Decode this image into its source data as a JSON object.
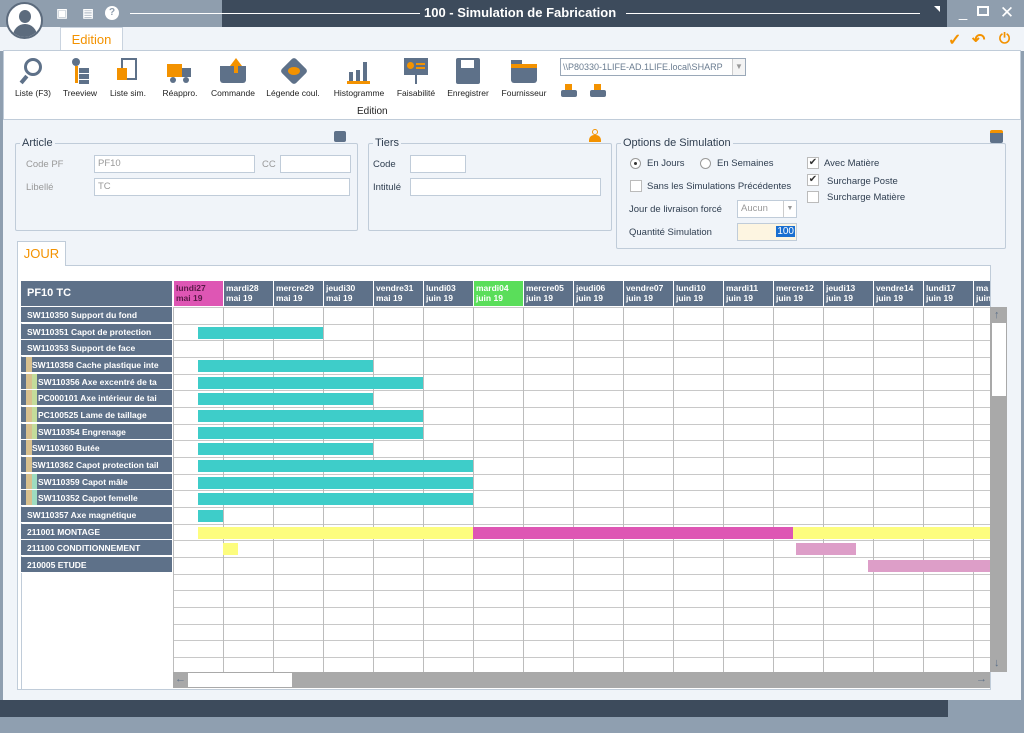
{
  "window": {
    "title": "100 - Simulation de Fabrication",
    "controls": [
      "minimize",
      "maximize",
      "close"
    ]
  },
  "titlebar_icons": [
    "monitor-icon",
    "calculator-icon",
    "help-icon"
  ],
  "ribbon_tab": "Edition",
  "actions": {
    "validate": "✓",
    "undo": "↶",
    "power": "⏻"
  },
  "toolbar": {
    "items": [
      {
        "label": "Liste (F3)",
        "icon": "search-icon"
      },
      {
        "label": "Treeview",
        "icon": "treeview-icon"
      },
      {
        "label": "Liste sim.",
        "icon": "document-list-icon"
      },
      {
        "label": "Réappro.",
        "icon": "truck-icon"
      },
      {
        "label": "Commande",
        "icon": "folder-upload-icon"
      },
      {
        "label": "Légende coul.",
        "icon": "eye-tag-icon"
      },
      {
        "label": "Histogramme",
        "icon": "bar-chart-icon"
      },
      {
        "label": "Faisabilité",
        "icon": "presentation-icon"
      },
      {
        "label": "Enregistrer",
        "icon": "save-icon"
      },
      {
        "label": "Fournisseur",
        "icon": "folder-icon"
      }
    ],
    "group_label": "Edition",
    "printer_path": "\\\\P80330-1LIFE-AD.1LIFE.local\\SHARP"
  },
  "article": {
    "title": "Article",
    "code_pf_label": "Code PF",
    "code_pf": "PF10",
    "cc_label": "CC",
    "cc": "",
    "libelle_label": "Libellé",
    "libelle": "TC"
  },
  "tiers": {
    "title": "Tiers",
    "code_label": "Code",
    "code": "",
    "intitule_label": "Intitulé",
    "intitule": ""
  },
  "options": {
    "title": "Options de Simulation",
    "en_jours": "En Jours",
    "en_semaines": "En Semaines",
    "mode": "En Jours",
    "sans_sim": "Sans les Simulations Précédentes",
    "sans_sim_checked": false,
    "avec_matiere": "Avec Matière",
    "avec_matiere_checked": true,
    "surcharge_poste": "Surcharge Poste",
    "surcharge_poste_checked": true,
    "surcharge_matiere": "Surcharge Matière",
    "surcharge_matiere_checked": false,
    "jour_livraison_label": "Jour de livraison forcé",
    "jour_livraison": "Aucun",
    "quantite_label": "Quantité Simulation",
    "quantite": "100"
  },
  "view_tab": "JOUR",
  "gantt": {
    "title": "PF10 TC",
    "colors": {
      "header": "#5e7189",
      "today": "#de56b4",
      "highlight": "#5ade5a",
      "bar": "#3ecdc9",
      "yellow": "#fdfd7e",
      "magenta": "#de56b4",
      "pink": "#dd9ec8"
    },
    "days": [
      {
        "d": "lundi27",
        "m": "mai 19",
        "mark": "today"
      },
      {
        "d": "mardi28",
        "m": "mai 19"
      },
      {
        "d": "mercre29",
        "m": "mai 19"
      },
      {
        "d": "jeudi30",
        "m": "mai 19"
      },
      {
        "d": "vendre31",
        "m": "mai 19"
      },
      {
        "d": "lundi03",
        "m": "juin 19"
      },
      {
        "d": "mardi04",
        "m": "juin 19",
        "mark": "highlight"
      },
      {
        "d": "mercre05",
        "m": "juin 19"
      },
      {
        "d": "jeudi06",
        "m": "juin 19"
      },
      {
        "d": "vendre07",
        "m": "juin 19"
      },
      {
        "d": "lundi10",
        "m": "juin 19"
      },
      {
        "d": "mardi11",
        "m": "juin 19"
      },
      {
        "d": "mercre12",
        "m": "juin 19"
      },
      {
        "d": "jeudi13",
        "m": "juin 19"
      },
      {
        "d": "vendre14",
        "m": "juin 19"
      },
      {
        "d": "lundi17",
        "m": "juin 19"
      },
      {
        "d": "ma",
        "m": "juin"
      }
    ],
    "rows": [
      {
        "label": "SW110350 Support du fond",
        "level": 0,
        "bars": []
      },
      {
        "label": "SW110351 Capot de protection",
        "level": 0,
        "bars": [
          {
            "start": 0.5,
            "end": 3,
            "color": "bar"
          }
        ]
      },
      {
        "label": "SW110353 Support de face",
        "level": 0,
        "bars": []
      },
      {
        "label": "SW110358 Cache plastique inte",
        "level": 1,
        "bars": [
          {
            "start": 0.5,
            "end": 4,
            "color": "bar"
          }
        ]
      },
      {
        "label": "SW110356 Axe excentré de ta",
        "level": 2,
        "group": "a",
        "bars": [
          {
            "start": 0.5,
            "end": 5,
            "color": "bar"
          }
        ]
      },
      {
        "label": "PC000101 Axe intérieur de tai",
        "level": 2,
        "group": "a",
        "bars": [
          {
            "start": 0.5,
            "end": 4,
            "color": "bar"
          }
        ]
      },
      {
        "label": "PC100525 Lame de taillage",
        "level": 2,
        "group": "a",
        "bars": [
          {
            "start": 0.5,
            "end": 5,
            "color": "bar"
          }
        ]
      },
      {
        "label": "SW110354 Engrenage",
        "level": 2,
        "group": "a",
        "bars": [
          {
            "start": 0.5,
            "end": 5,
            "color": "bar"
          }
        ]
      },
      {
        "label": "SW110360 Butée",
        "level": 1,
        "bars": [
          {
            "start": 0.5,
            "end": 4,
            "color": "bar"
          }
        ]
      },
      {
        "label": "SW110362 Capot protection tail",
        "level": 1,
        "bars": [
          {
            "start": 0.5,
            "end": 6,
            "color": "bar"
          }
        ]
      },
      {
        "label": "SW110359 Capot mâle",
        "level": 2,
        "group": "b",
        "bars": [
          {
            "start": 0.5,
            "end": 6,
            "color": "bar"
          }
        ]
      },
      {
        "label": "SW110352 Capot femelle",
        "level": 2,
        "group": "b",
        "bars": [
          {
            "start": 0.5,
            "end": 6,
            "color": "bar"
          }
        ]
      },
      {
        "label": "SW110357 Axe magnétique",
        "level": 0,
        "bars": [
          {
            "start": 0.5,
            "end": 1,
            "color": "bar"
          }
        ]
      },
      {
        "label": "211001 MONTAGE",
        "level": 0,
        "bars": [
          {
            "start": 0.5,
            "end": 6,
            "color": "yellow"
          },
          {
            "start": 6,
            "end": 12.4,
            "color": "magenta"
          },
          {
            "start": 12.4,
            "end": 16.4,
            "color": "yellow"
          }
        ]
      },
      {
        "label": "211100 CONDITIONNEMENT",
        "level": 0,
        "bars": [
          {
            "start": 1,
            "end": 1.3,
            "color": "yellow"
          },
          {
            "start": 12.45,
            "end": 13.65,
            "color": "pink"
          }
        ]
      },
      {
        "label": "210005 ETUDE",
        "level": 0,
        "bars": [
          {
            "start": 13.9,
            "end": 16.4,
            "color": "pink"
          }
        ]
      }
    ]
  }
}
